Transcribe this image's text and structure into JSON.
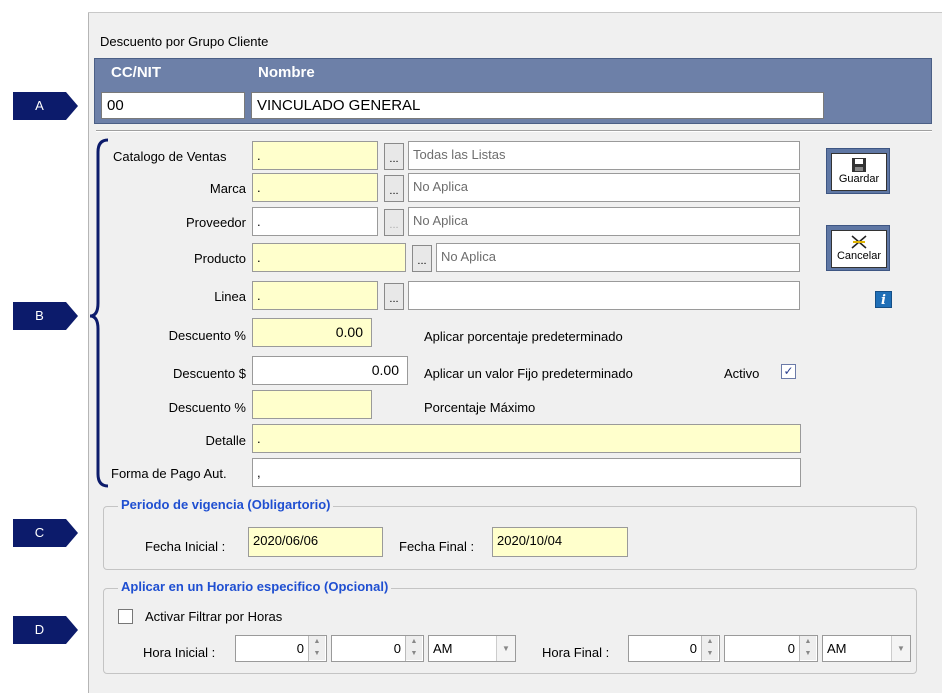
{
  "window": {
    "title": "Descuento por Grupo Cliente"
  },
  "header": {
    "id_label": "CC/NIT",
    "name_label": "Nombre",
    "id_value": "00",
    "name_value": "VINCULADO GENERAL"
  },
  "form": {
    "catalogo": {
      "label": "Catalogo de Ventas",
      "value": ".",
      "desc": "Todas las Listas"
    },
    "marca": {
      "label": "Marca",
      "value": ".",
      "desc": "No Aplica"
    },
    "proveedor": {
      "label": "Proveedor",
      "value": ".",
      "desc": "No Aplica"
    },
    "producto": {
      "label": "Producto",
      "value": ".",
      "desc": "No Aplica"
    },
    "linea": {
      "label": "Linea",
      "value": ".",
      "desc": ""
    },
    "lookup_label": "...",
    "descuento_pct": {
      "label": "Descuento %",
      "value": "0.00",
      "note": "Aplicar porcentaje predeterminado"
    },
    "descuento_val": {
      "label": "Descuento $",
      "value": "0.00",
      "note": "Aplicar un valor Fijo predeterminado"
    },
    "descuento_max": {
      "label": "Descuento %",
      "value": "",
      "note": "Porcentaje Máximo"
    },
    "detalle": {
      "label": "Detalle",
      "value": "."
    },
    "forma_pago": {
      "label": "Forma de Pago Aut.",
      "value": ","
    },
    "activo": {
      "label": "Activo",
      "checked": true
    }
  },
  "buttons": {
    "save_label": "Guardar",
    "cancel_label": "Cancelar",
    "info_label": "i"
  },
  "vigencia": {
    "title": "Periodo de vigencia  (Obligartorio)",
    "start_label": "Fecha Inicial :",
    "start_value": "2020/06/06",
    "end_label": "Fecha Final :",
    "end_value": "2020/10/04"
  },
  "horario": {
    "title": "Aplicar en un Horario  especifico  (Opcional)",
    "filter_label": "Activar Filtrar por Horas",
    "filter_checked": false,
    "start_label": "Hora Inicial :",
    "start_hour": "0",
    "start_min": "0",
    "start_ampm": "AM",
    "end_label": "Hora Final :",
    "end_hour": "0",
    "end_min": "0",
    "end_ampm": "AM"
  },
  "markers": [
    "A",
    "B",
    "C",
    "D"
  ],
  "colors": {
    "panel": "#6d80a8",
    "marker": "#0c1b6b",
    "group_title": "#1f4fd1",
    "field_yellow": "#ffffcc"
  }
}
